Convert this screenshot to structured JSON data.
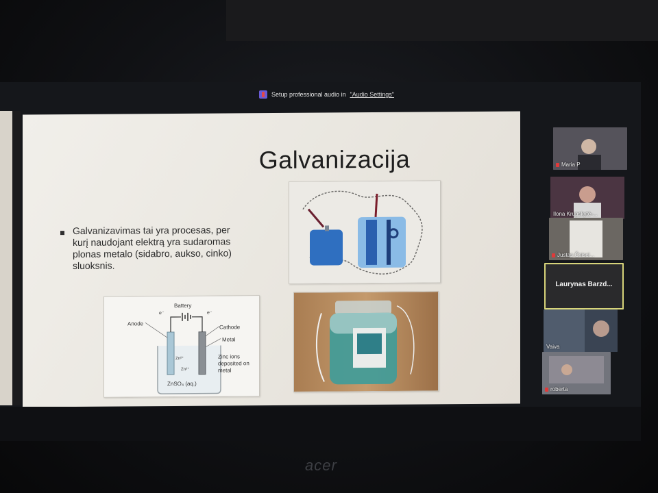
{
  "notice": {
    "text_prefix": "Setup professional audio in ",
    "link_text": "\"Audio Settings\""
  },
  "slide": {
    "title": "Galvanizacija",
    "bullet": "Galvanizavimas tai yra procesas, per kurį naudojant elektrą yra sudaromas plonas metalo (sidabro, aukso, cinko) sluoksnis.",
    "diagram": {
      "battery": "Battery",
      "e_left": "e⁻",
      "e_right": "e⁻",
      "anode": "Anode",
      "cathode": "Cathode",
      "metal": "Metal",
      "zinc_ions": "Zinc ions deposited on metal",
      "zn1": "Zn²⁺",
      "zn2": "Zn²⁺",
      "solution": "ZnSO₄ (aq.)"
    }
  },
  "participants": [
    {
      "name": "Maria P"
    },
    {
      "name": "Ilona Krupskytė-..."
    },
    {
      "name": "Justas Čnisci..."
    },
    {
      "name": "Laurynas  Barzd..."
    },
    {
      "name": "Vaiva"
    },
    {
      "name": "roberta"
    }
  ],
  "brand": "acer",
  "colors": {
    "bezel": "#101114",
    "slide_bg": "#efece6",
    "active_speaker_border": "#d7d47a",
    "mic_muted": "#e03a3a"
  }
}
